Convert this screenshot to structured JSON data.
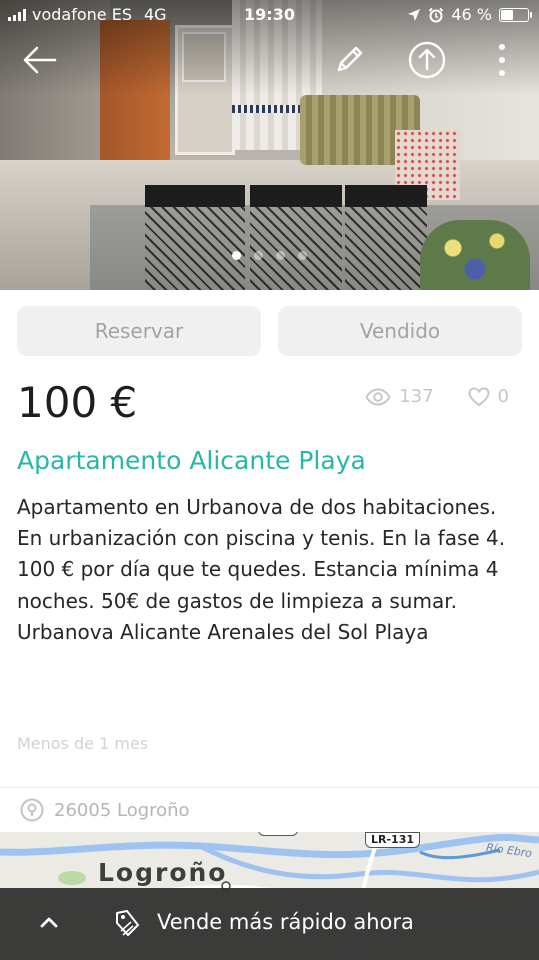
{
  "status_bar": {
    "carrier": "vodafone ES",
    "network": "4G",
    "time": "19:30",
    "battery": "46 %",
    "battery_level": 0.46
  },
  "gallery": {
    "photo_count": 4,
    "active_index": 0
  },
  "nav": {
    "back_icon": "arrow-left-icon",
    "edit_icon": "pencil-icon",
    "share_icon": "share-icon",
    "more_icon": "more-vertical-icon"
  },
  "actions": {
    "reserve_label": "Reservar",
    "sold_label": "Vendido"
  },
  "listing": {
    "price": "100 €",
    "views": "137",
    "likes": "0",
    "title": "Apartamento Alicante Playa",
    "description": "Apartamento en Urbanova de dos habitaciones. En urbanización con piscina y tenis. En la fase 4.\n100 € por día que te quedes. Estancia mínima 4 noches. 50€ de gastos de limpieza a sumar.\n Urbanova Alicante Arenales del Sol Playa",
    "posted": "Menos de 1 mes",
    "location": "26005 Logroño"
  },
  "map": {
    "city_label": "Logroño",
    "road_label": "LR-131",
    "river_label": "Río Ebro"
  },
  "bottom_bar": {
    "label": "Vende más rápido ahora",
    "chevron_icon": "chevron-up-icon",
    "tag_icon": "tag-icon"
  },
  "colors": {
    "accent": "#27b7a8",
    "muted": "#c7c7c7",
    "button_bg": "#f0f0f0",
    "bottom_bar_bg": "#2d2d2d"
  }
}
